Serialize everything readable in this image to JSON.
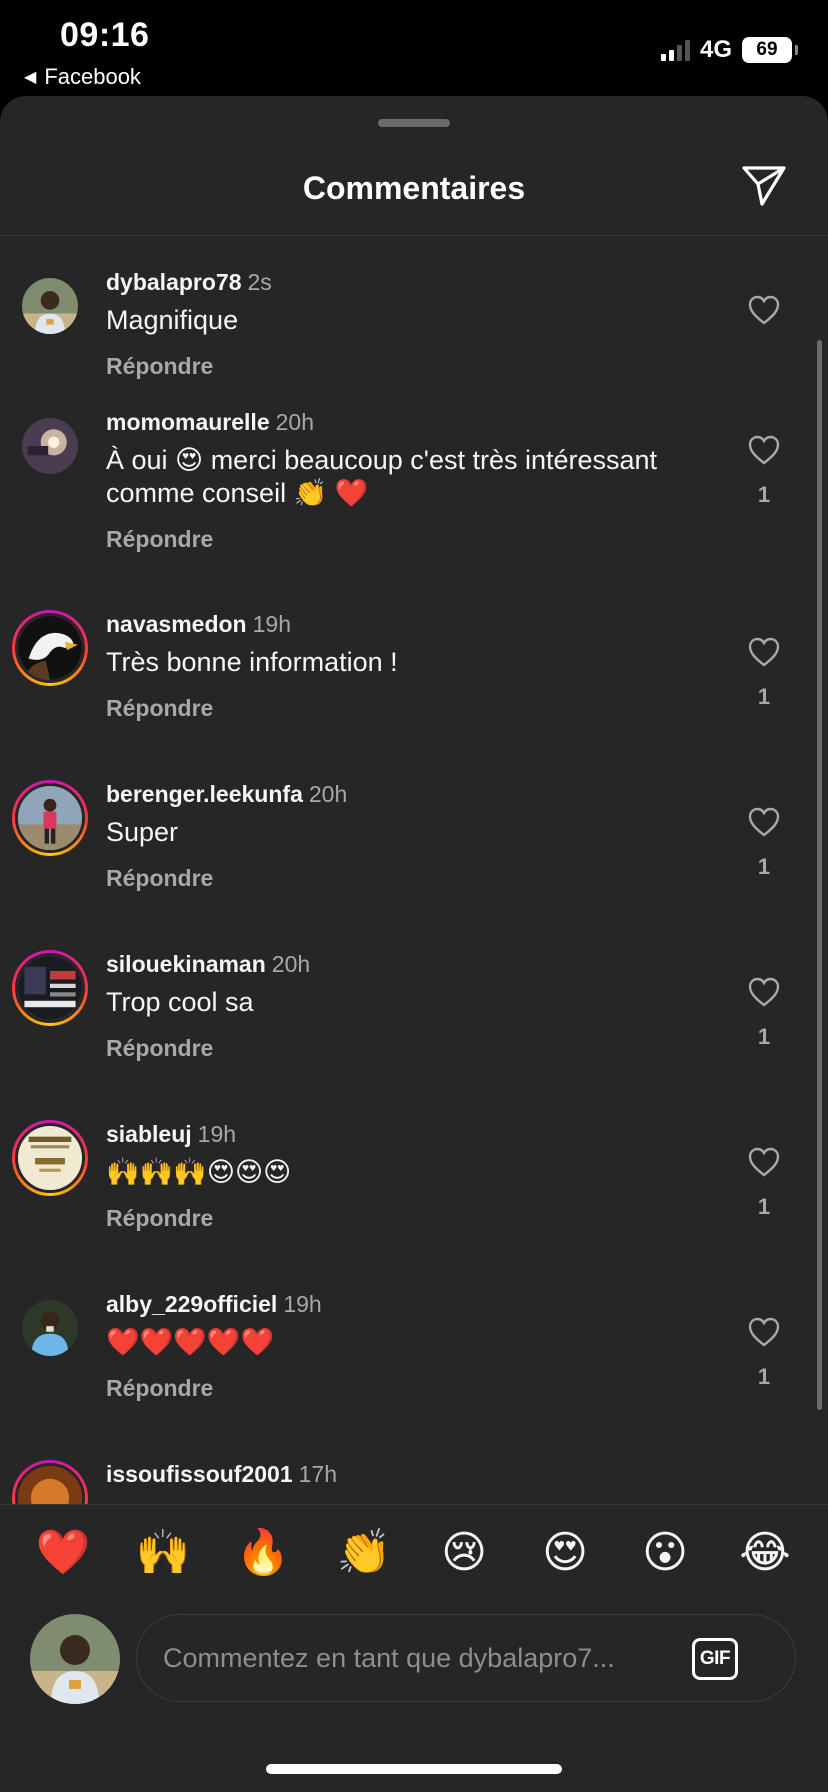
{
  "status_bar": {
    "time": "09:16",
    "back_app": "Facebook",
    "network": "4G",
    "battery": "69"
  },
  "header": {
    "title": "Commentaires"
  },
  "comments": [
    {
      "username": "dybalapro78",
      "time": "2s",
      "text": "Magnifique",
      "reply": "Répondre",
      "likes": ""
    },
    {
      "username": "momomaurelle",
      "time": "20h",
      "text": "À oui 😍 merci beaucoup c'est très intéressant comme conseil 👏 ❤️",
      "reply": "Répondre",
      "likes": "1"
    },
    {
      "username": "navasmedon",
      "time": "19h",
      "text": "Très bonne information !",
      "reply": "Répondre",
      "likes": "1"
    },
    {
      "username": "berenger.leekunfa",
      "time": "20h",
      "text": "Super",
      "reply": "Répondre",
      "likes": "1"
    },
    {
      "username": "silouekinaman",
      "time": "20h",
      "text": "Trop cool sa",
      "reply": "Répondre",
      "likes": "1"
    },
    {
      "username": "siableuj",
      "time": "19h",
      "text": "🙌🙌🙌😍😍😍",
      "reply": "Répondre",
      "likes": "1"
    },
    {
      "username": "alby_229officiel",
      "time": "19h",
      "text": "❤️❤️❤️❤️❤️",
      "reply": "Répondre",
      "likes": "1"
    },
    {
      "username": "issoufissouf2001",
      "time": "17h",
      "text": "",
      "reply": "",
      "likes": ""
    }
  ],
  "reactions": [
    "❤️",
    "🙌",
    "🔥",
    "👏",
    "😢",
    "😍",
    "😮",
    "😂"
  ],
  "input": {
    "placeholder": "Commentez en tant que dybalapro7...",
    "gif_label": "GIF"
  },
  "colors": {
    "sheet_bg": "#262626",
    "secondary_text": "#a8a8a8",
    "story_ring": "#c913b9"
  }
}
